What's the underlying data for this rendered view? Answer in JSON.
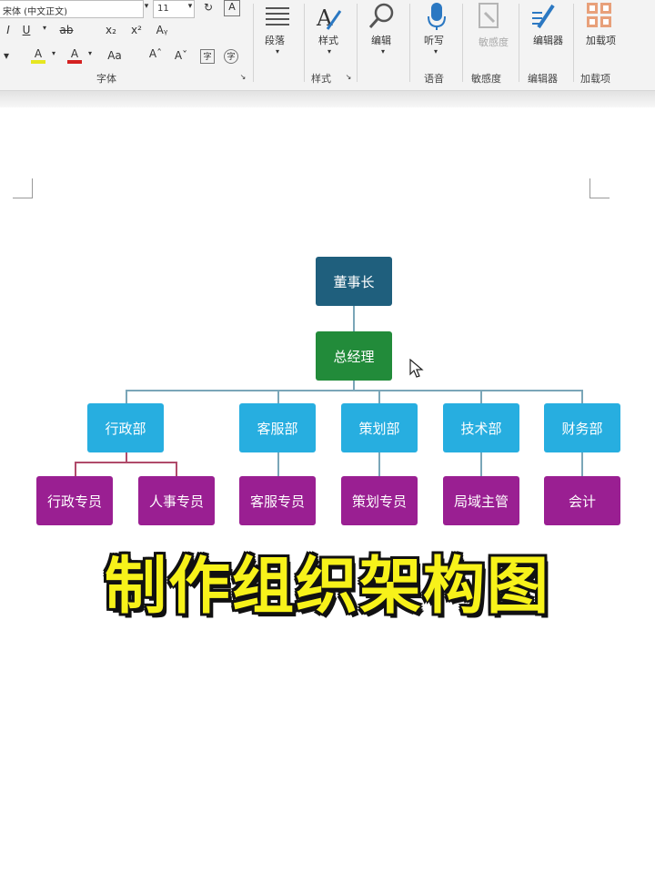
{
  "ribbon": {
    "font_name": "宋体 (中文正文)",
    "font_size": "11",
    "font_group_label": "字体",
    "paragraph_label": "段落",
    "style_button": "样式",
    "style_group_label": "样式",
    "edit_button": "编辑",
    "dictate_button": "听写",
    "voice_group_label": "语音",
    "sensitivity_button": "敏感度",
    "sensitivity_group_label": "敏感度",
    "editor_button": "编辑器",
    "editor_group_label": "编辑器",
    "addins_button": "加载项",
    "addins_group_label": "加载项",
    "format_buttons": [
      "I",
      "U",
      "ab",
      "x₂",
      "x²",
      "Aᵧ"
    ],
    "format_buttons2": [
      "A",
      "A",
      "Aa",
      "Aˆ",
      "Aˇ"
    ]
  },
  "org_chart": {
    "chairman": "董事长",
    "general_manager": "总经理",
    "departments": [
      {
        "name": "行政部",
        "staff": [
          "行政专员",
          "人事专员"
        ]
      },
      {
        "name": "客服部",
        "staff": [
          "客服专员"
        ]
      },
      {
        "name": "策划部",
        "staff": [
          "策划专员"
        ]
      },
      {
        "name": "技术部",
        "staff": [
          "局域主管"
        ]
      },
      {
        "name": "财务部",
        "staff": [
          "会计"
        ]
      }
    ],
    "colors": {
      "chairman": "#1f5f7d",
      "general_manager": "#228b3a",
      "department": "#27aee0",
      "staff": "#9a1f92",
      "connector": "#7aa6b8"
    }
  },
  "banner": {
    "text": "制作组织架构图"
  },
  "icons": [
    "paragraph-icon",
    "style-icon",
    "search-icon",
    "microphone-icon",
    "sensitivity-icon",
    "editor-icon",
    "addins-icon",
    "cursor-icon"
  ]
}
